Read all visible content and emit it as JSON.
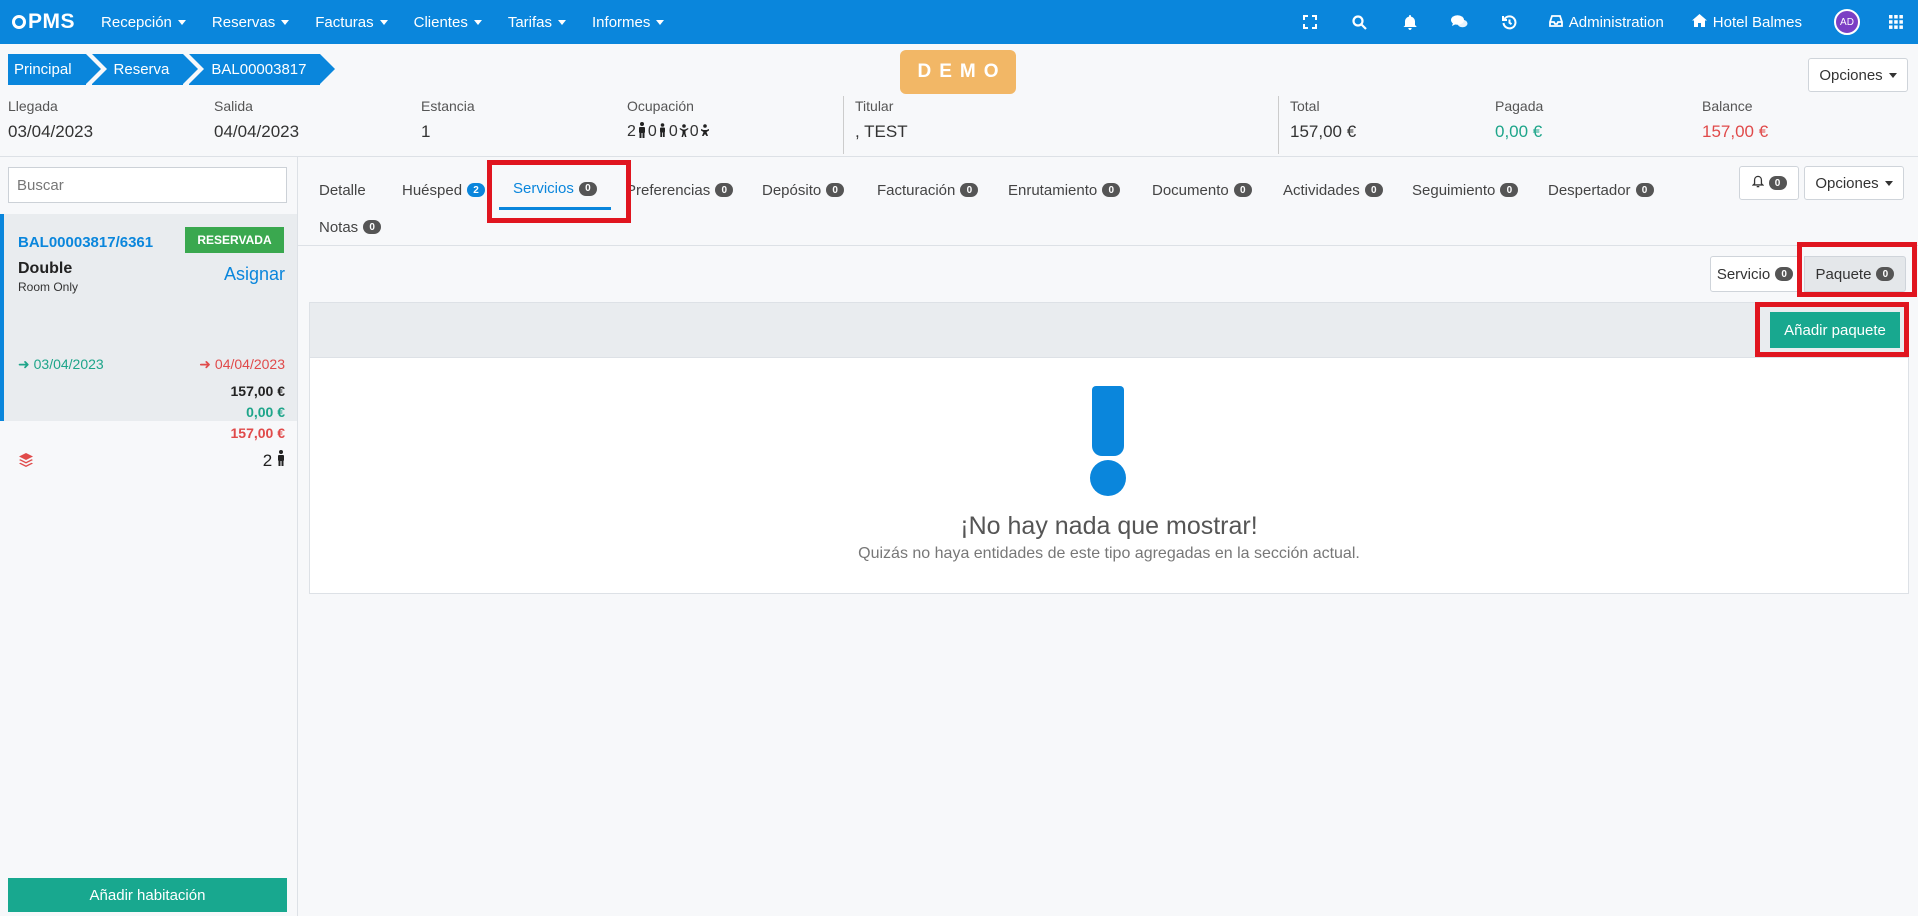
{
  "nav": {
    "logo": "PMS",
    "menu": [
      {
        "label": "Recepción"
      },
      {
        "label": "Reservas"
      },
      {
        "label": "Facturas"
      },
      {
        "label": "Clientes"
      },
      {
        "label": "Tarifas"
      },
      {
        "label": "Informes"
      }
    ],
    "admin_label": "Administration",
    "hotel_label": "Hotel Balmes",
    "avatar_initials": "AD",
    "color": "#0a86dc"
  },
  "breadcrumb": [
    "Principal",
    "Reserva",
    "BAL00003817"
  ],
  "demo_badge": "DEMO",
  "options_label": "Opciones",
  "reservation": {
    "arrival_label": "Llegada",
    "arrival": "03/04/2023",
    "departure_label": "Salida",
    "departure": "04/04/2023",
    "stay_label": "Estancia",
    "stay": "1",
    "occupancy_label": "Ocupación",
    "occupancy": {
      "adults": "2",
      "juniors": "0",
      "children": "0",
      "babies": "0"
    },
    "holder_label": "Titular",
    "holder": ", TEST",
    "total_label": "Total",
    "total": "157,00 €",
    "paid_label": "Pagada",
    "paid": "0,00 €",
    "balance_label": "Balance",
    "balance": "157,00 €"
  },
  "sidebar": {
    "search_placeholder": "Buscar",
    "room": {
      "code": "BAL00003817/6361",
      "status": "RESERVADA",
      "type": "Double",
      "plan": "Room Only",
      "assign_label": "Asignar",
      "arrival": "03/04/2023",
      "departure": "04/04/2023",
      "total": "157,00 €",
      "paid": "0,00 €",
      "balance": "157,00 €",
      "occupants": "2"
    },
    "add_room_label": "Añadir habitación"
  },
  "tabs": [
    {
      "label": "Detalle",
      "count": ""
    },
    {
      "label": "Huésped",
      "count": "2"
    },
    {
      "label": "Servicios",
      "count": "0"
    },
    {
      "label": "Preferencias",
      "count": "0"
    },
    {
      "label": "Depósito",
      "count": "0"
    },
    {
      "label": "Facturación",
      "count": "0"
    },
    {
      "label": "Enrutamiento",
      "count": "0"
    },
    {
      "label": "Documento",
      "count": "0"
    },
    {
      "label": "Actividades",
      "count": "0"
    },
    {
      "label": "Seguimiento",
      "count": "0"
    },
    {
      "label": "Despertador",
      "count": "0"
    },
    {
      "label": "Notas",
      "count": "0"
    }
  ],
  "tab_tools": {
    "bell_count": "0",
    "options_label": "Opciones"
  },
  "subtabs": {
    "service_label": "Servicio",
    "service_count": "0",
    "package_label": "Paquete",
    "package_count": "0"
  },
  "add_package_label": "Añadir paquete",
  "empty_state": {
    "title": "¡No hay nada que mostrar!",
    "subtitle": "Quizás no haya entidades de este tipo agregadas en la sección actual."
  },
  "colors": {
    "primary": "#0a86dc",
    "success": "#18a88f",
    "status_green": "#3aa84f",
    "danger": "#e04a4a",
    "demo": "#f2b766",
    "highlight": "#e0151f"
  }
}
